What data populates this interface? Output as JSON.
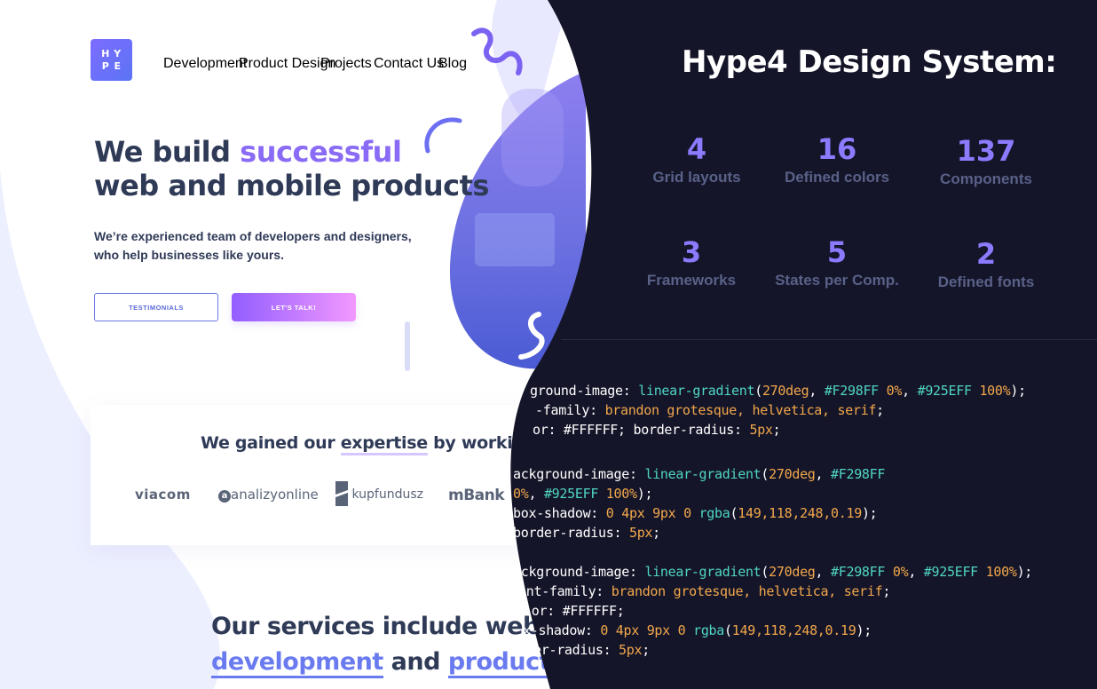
{
  "left_page": {
    "logo_letters": [
      "H",
      "Y",
      "P",
      "E"
    ],
    "nav": [
      "Development",
      "Product Design",
      "Projects",
      "Contact Us",
      "Blog"
    ],
    "hero_title_line1_a": "We build ",
    "hero_title_line1_b": "successful",
    "hero_title_line2": "web and mobile products",
    "hero_sub_line1": "We’re experienced team of developers and designers,",
    "hero_sub_line2": "who help businesses like yours.",
    "btn_testimonials": "TESTIMONIALS",
    "btn_talk": "LET'S TALK!",
    "clients_title_a": "We gained our ",
    "clients_title_b": "expertise",
    "clients_title_c": " by working for clie",
    "brands": [
      "viacom",
      "analizyonline",
      "kupfundusz",
      "mBank"
    ],
    "services_a": "Our services include web & ",
    "services_b1": "development",
    "services_b2": " and ",
    "services_b3": "product de"
  },
  "design_system": {
    "title": "Hype4 Design System:",
    "stats": [
      {
        "num": "4",
        "label": "Grid layouts"
      },
      {
        "num": "16",
        "label": "Defined colors"
      },
      {
        "num": "137",
        "label": "Components"
      },
      {
        "num": "3",
        "label": "Frameworks"
      },
      {
        "num": "5",
        "label": "States per Comp."
      },
      {
        "num": "2",
        "label": "Defined fonts"
      }
    ],
    "code": [
      [
        [
          "pl",
          "ground-image: "
        ],
        [
          "fn",
          "linear-gradient"
        ],
        [
          "pl",
          "("
        ],
        [
          "v",
          "270deg"
        ],
        [
          "pl",
          ", "
        ],
        [
          "fn",
          "#F298FF"
        ],
        [
          "v",
          " 0%"
        ],
        [
          "pl",
          ", "
        ],
        [
          "fn",
          "#925EFF"
        ],
        [
          "v",
          " 100%"
        ],
        [
          "pl",
          ");"
        ]
      ],
      [
        [
          "pl",
          "-family: "
        ],
        [
          "v",
          "brandon grotesque, helvetica, serif"
        ],
        [
          "pl",
          ";"
        ]
      ],
      [
        [
          "pl",
          "or: #FFFFFF; border-radius: "
        ],
        [
          "v",
          "5px"
        ],
        [
          "pl",
          ";"
        ]
      ],
      [],
      [
        [
          "pl",
          "ackground-image: "
        ],
        [
          "fn",
          "linear-gradient"
        ],
        [
          "pl",
          "("
        ],
        [
          "v",
          "270deg"
        ],
        [
          "pl",
          ", "
        ],
        [
          "fn",
          "#F298FF"
        ]
      ],
      [
        [
          "v",
          "0%"
        ],
        [
          "pl",
          ", "
        ],
        [
          "fn",
          "#925EFF"
        ],
        [
          "v",
          " 100%"
        ],
        [
          "pl",
          ");"
        ]
      ],
      [
        [
          "pl",
          "box-shadow: "
        ],
        [
          "v",
          "0 4px 9px 0 "
        ],
        [
          "fn",
          "rgba"
        ],
        [
          "pl",
          "("
        ],
        [
          "v",
          "149,118,248,0.19"
        ],
        [
          "pl",
          ");"
        ]
      ],
      [
        [
          "pl",
          "border-radius: "
        ],
        [
          "v",
          "5px"
        ],
        [
          "pl",
          ";"
        ]
      ],
      [],
      [
        [
          "pl",
          "ackground-image: "
        ],
        [
          "fn",
          "linear-gradient"
        ],
        [
          "pl",
          "("
        ],
        [
          "v",
          "270deg"
        ],
        [
          "pl",
          ", "
        ],
        [
          "fn",
          "#F298FF"
        ],
        [
          "v",
          " 0%"
        ],
        [
          "pl",
          ", "
        ],
        [
          "fn",
          "#925EFF"
        ],
        [
          "v",
          " 100%"
        ],
        [
          "pl",
          ");"
        ]
      ],
      [
        [
          "pl",
          "ont-family: "
        ],
        [
          "v",
          "brandon grotesque, helvetica, serif"
        ],
        [
          "pl",
          ";"
        ]
      ],
      [
        [
          "pl",
          "lor: #FFFFFF;"
        ]
      ],
      [
        [
          "pl",
          "x-shadow: "
        ],
        [
          "v",
          "0 4px 9px 0 "
        ],
        [
          "fn",
          "rgba"
        ],
        [
          "pl",
          "("
        ],
        [
          "v",
          "149,118,248,0.19"
        ],
        [
          "pl",
          ");"
        ]
      ],
      [
        [
          "pl",
          "er-radius: "
        ],
        [
          "v",
          "5px"
        ],
        [
          "pl",
          ";"
        ]
      ]
    ]
  },
  "colors": {
    "accent": "#8a6bf5",
    "dark_bg": "#15152a",
    "stat_num": "#8b7bff",
    "code_fn": "#4fd6c3",
    "code_val": "#f2a84a"
  }
}
